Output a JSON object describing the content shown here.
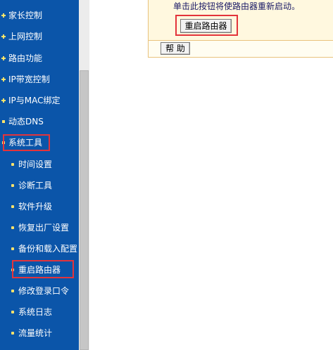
{
  "sidebar": {
    "items": [
      {
        "label": "家长控制",
        "level": "top"
      },
      {
        "label": "上网控制",
        "level": "top"
      },
      {
        "label": "路由功能",
        "level": "top"
      },
      {
        "label": "IP带宽控制",
        "level": "top"
      },
      {
        "label": "IP与MAC绑定",
        "level": "top"
      },
      {
        "label": "动态DNS",
        "level": "top"
      },
      {
        "label": "系统工具",
        "level": "top",
        "expanded": true
      },
      {
        "label": "时间设置",
        "level": "sub"
      },
      {
        "label": "诊断工具",
        "level": "sub"
      },
      {
        "label": "软件升级",
        "level": "sub"
      },
      {
        "label": "恢复出厂设置",
        "level": "sub"
      },
      {
        "label": "备份和载入配置",
        "level": "sub"
      },
      {
        "label": "重启路由器",
        "level": "sub",
        "selected": true
      },
      {
        "label": "修改登录口令",
        "level": "sub"
      },
      {
        "label": "系统日志",
        "level": "sub"
      },
      {
        "label": "流量统计",
        "level": "sub"
      }
    ]
  },
  "main": {
    "description": "单击此按钮将使路由器重新启动。",
    "reboot_button": "重启路由器",
    "help_button": "帮 助"
  },
  "colors": {
    "sidebar_bg": "#0b55a9",
    "bullet": "#ffe36b",
    "highlight_box": "#e3343b",
    "panel_bg": "#fff8df"
  }
}
